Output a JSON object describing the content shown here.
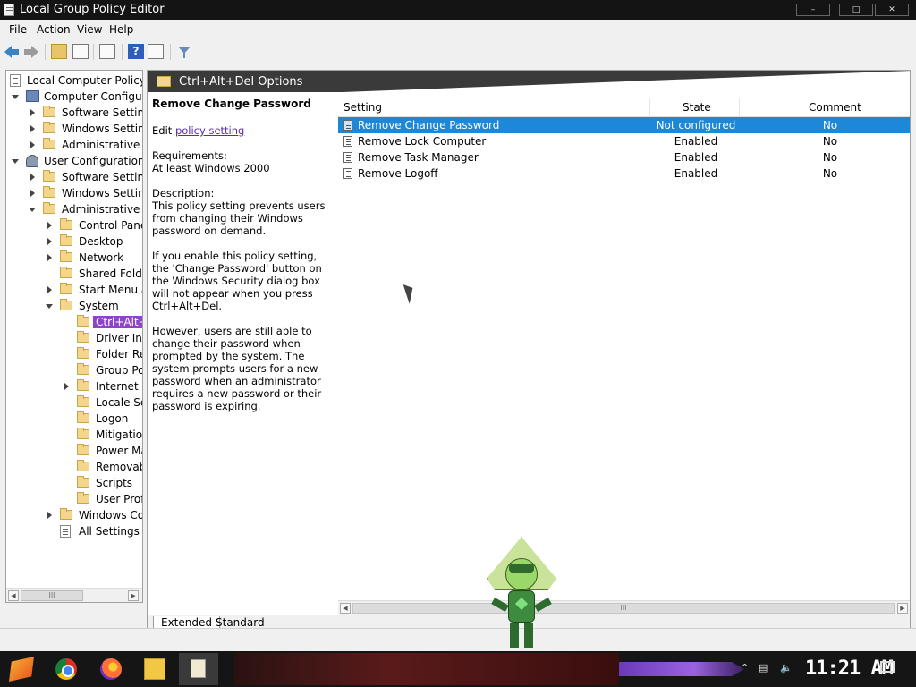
{
  "window": {
    "title": "Local Group Policy Editor",
    "controls": [
      "–",
      "□",
      "✕"
    ]
  },
  "menu": {
    "items": [
      "File",
      "Action",
      "View",
      "Help"
    ]
  },
  "toolbar": {
    "icons": [
      "back-arrow-icon",
      "forward-arrow-icon",
      "up-folder-icon",
      "show-hide-tree-icon",
      "export-list-icon",
      "help-icon",
      "properties-icon",
      "filter-icon"
    ],
    "help_label": "?"
  },
  "tree": {
    "items": [
      {
        "label": "Local Computer Policy",
        "icon": "policy-doc-icon"
      },
      {
        "label": "Computer Configuration",
        "icon": "computer-icon"
      },
      {
        "label": "Software Settings",
        "icon": "folder-icon"
      },
      {
        "label": "Windows Settings",
        "icon": "folder-icon"
      },
      {
        "label": "Administrative Templates",
        "icon": "folder-icon"
      },
      {
        "label": "User Configuration",
        "icon": "user-icon"
      },
      {
        "label": "Software Settings",
        "icon": "folder-icon"
      },
      {
        "label": "Windows Settings",
        "icon": "folder-icon"
      },
      {
        "label": "Administrative Templates",
        "icon": "folder-icon"
      },
      {
        "label": "Control Panel",
        "icon": "folder-icon"
      },
      {
        "label": "Desktop",
        "icon": "folder-icon"
      },
      {
        "label": "Network",
        "icon": "folder-icon"
      },
      {
        "label": "Shared Folders",
        "icon": "folder-icon"
      },
      {
        "label": "Start Menu and Taskbar",
        "icon": "folder-icon"
      },
      {
        "label": "System",
        "icon": "folder-icon"
      },
      {
        "label": "Ctrl+Alt+Del Options",
        "icon": "folder-icon"
      },
      {
        "label": "Driver Installation",
        "icon": "folder-icon"
      },
      {
        "label": "Folder Redirection",
        "icon": "folder-icon"
      },
      {
        "label": "Group Policy",
        "icon": "folder-icon"
      },
      {
        "label": "Internet Communication Management",
        "icon": "folder-icon"
      },
      {
        "label": "Locale Services",
        "icon": "folder-icon"
      },
      {
        "label": "Logon",
        "icon": "folder-icon"
      },
      {
        "label": "Mitigation Options",
        "icon": "folder-icon"
      },
      {
        "label": "Power Management",
        "icon": "folder-icon"
      },
      {
        "label": "Removable Storage Access",
        "icon": "folder-icon"
      },
      {
        "label": "Scripts",
        "icon": "folder-icon"
      },
      {
        "label": "User Profiles",
        "icon": "folder-icon"
      },
      {
        "label": "Windows Components",
        "icon": "folder-icon"
      },
      {
        "label": "All Settings",
        "icon": "all-settings-icon"
      }
    ],
    "scroll_thumb": "III"
  },
  "header": {
    "title": "Ctrl+Alt+Del Options"
  },
  "description": {
    "title": "Remove Change Password",
    "edit_prefix": "Edit",
    "edit_link": "policy setting",
    "requirements_label": "Requirements:",
    "requirements_value": "At least Windows 2000",
    "description_label": "Description:",
    "para1": "This policy setting prevents users from changing their Windows password on demand.",
    "para2": "If you enable this policy setting, the 'Change Password' button on the Windows Security dialog box will not appear when you press Ctrl+Alt+Del.",
    "para3": "However, users are still able to change their password when prompted by the system. The system prompts users for a new password when an administrator requires a new password or their password is expiring."
  },
  "list": {
    "columns": [
      "Setting",
      "State",
      "Comment"
    ],
    "rows": [
      {
        "setting": "Remove Change Password",
        "state": "Not configured",
        "comment": "No"
      },
      {
        "setting": "Remove Lock Computer",
        "state": "Enabled",
        "comment": "No"
      },
      {
        "setting": "Remove Task Manager",
        "state": "Enabled",
        "comment": "No"
      },
      {
        "setting": "Remove Logoff",
        "state": "Enabled",
        "comment": "No"
      }
    ],
    "scroll_thumb": "III"
  },
  "tabs": [
    "Extended",
    "Standard"
  ],
  "taskbar": {
    "clock": "11:21 AM",
    "tray_chevron": "^",
    "apps": [
      "start-icon",
      "chrome-icon",
      "firefox-icon",
      "file-explorer-icon",
      "group-policy-editor-icon"
    ]
  },
  "colors": {
    "selection_tree": "#8e44c8",
    "selection_list": "#1e88d8",
    "link": "#5a2ca8"
  }
}
